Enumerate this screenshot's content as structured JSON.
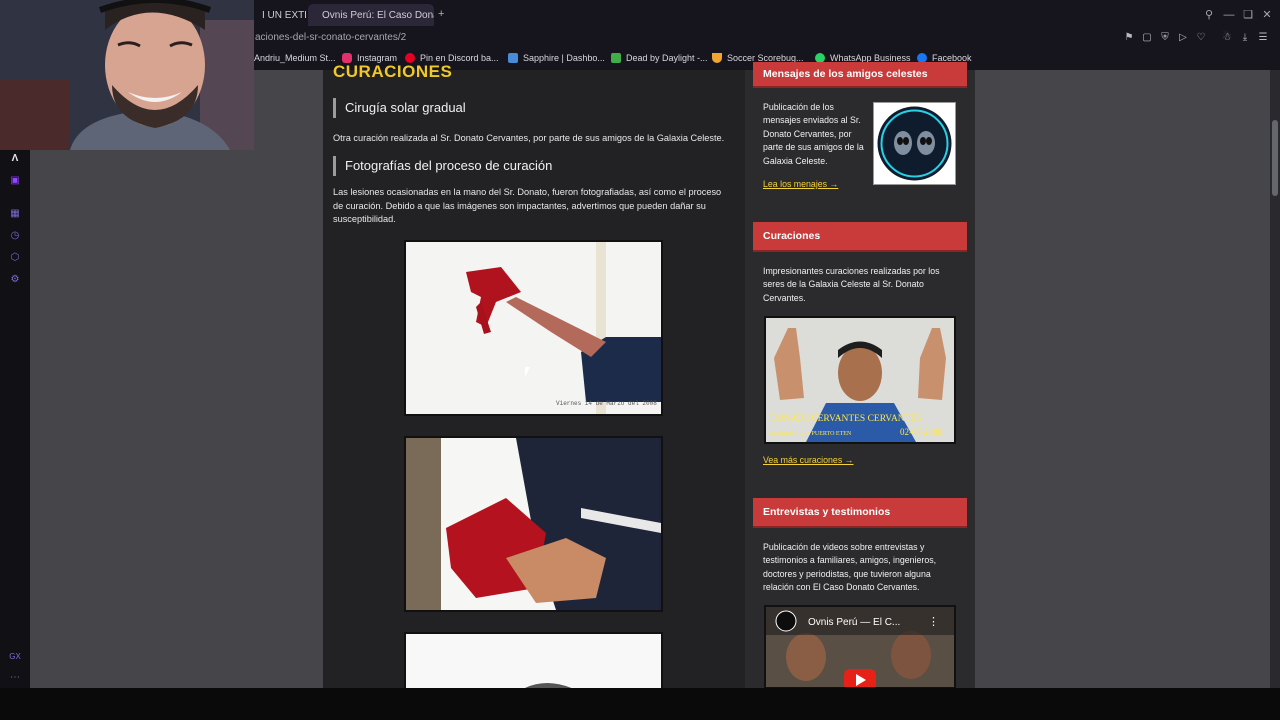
{
  "browser": {
    "tabs": [
      {
        "title": "I UN EXTRA"
      },
      {
        "title": "Ovnis Perú: El Caso Donato"
      }
    ],
    "new_tab": "+",
    "url": "aciones-del-sr-conato-cervantes/2",
    "bookmarks": [
      {
        "label": "Andriu_Medium St...",
        "color": "#ffffff"
      },
      {
        "label": "Instagram",
        "color": "#e1306c"
      },
      {
        "label": "Pin en Discord ba...",
        "color": "#e60023"
      },
      {
        "label": "Sapphire | Dashbo...",
        "color": "#4a8bd8"
      },
      {
        "label": "Dead by Daylight -...",
        "color": "#3fae4a"
      },
      {
        "label": "Soccer Scorebug...",
        "color": "#f2a431"
      },
      {
        "label": "WhatsApp Business",
        "color": "#25d366"
      },
      {
        "label": "Facebook",
        "color": "#1877f2"
      }
    ]
  },
  "article": {
    "top_heading": "CURACIONES",
    "section1_title": "Cirugía solar gradual",
    "section1_text": "Otra curación realizada al Sr. Donato Cervantes, por parte de sus amigos de la Galaxia Celeste.",
    "section2_title": "Fotografías del proceso de curación",
    "section2_text": "Las lesiones ocasionadas en la mano del Sr. Donato, fueron fotografiadas, así como el proceso de curación. Debido a que las imágenes son impactantes, advertimos que pueden dañar su susceptibilidad.",
    "photo1_caption": "Viernes 14 de Marzo del 2008"
  },
  "sidebar": {
    "widget1": {
      "title": "Mensajes de los amigos celestes",
      "text": "Publicación de los mensajes enviados al Sr. Donato Cervantes, por parte de sus amigos de la Galaxia Celeste.",
      "link": "Lea los menajes →"
    },
    "widget2": {
      "title": "Curaciones",
      "text": "Impresionantes curaciones realizadas por los seres de la Galaxia Celeste al Sr. Donato Cervantes.",
      "image_caption_name": "DONATO CERVANTES CERVANTES",
      "image_caption_place": "RECEPTOR DE PUERTO ETEN",
      "image_caption_date": "02-07-2008",
      "link": "Vea más curaciones →"
    },
    "widget3": {
      "title": "Entrevistas y testimonios",
      "text": "Publicación de videos sobre entrevistas y testimonios a familiares, amigos, ingenieros, doctores y periodistas, que tuvieron alguna relación con El Caso Donato Cervantes.",
      "video_title": "Ovnis Perú — El C..."
    }
  },
  "rail": {
    "bottom_label": "GX"
  }
}
